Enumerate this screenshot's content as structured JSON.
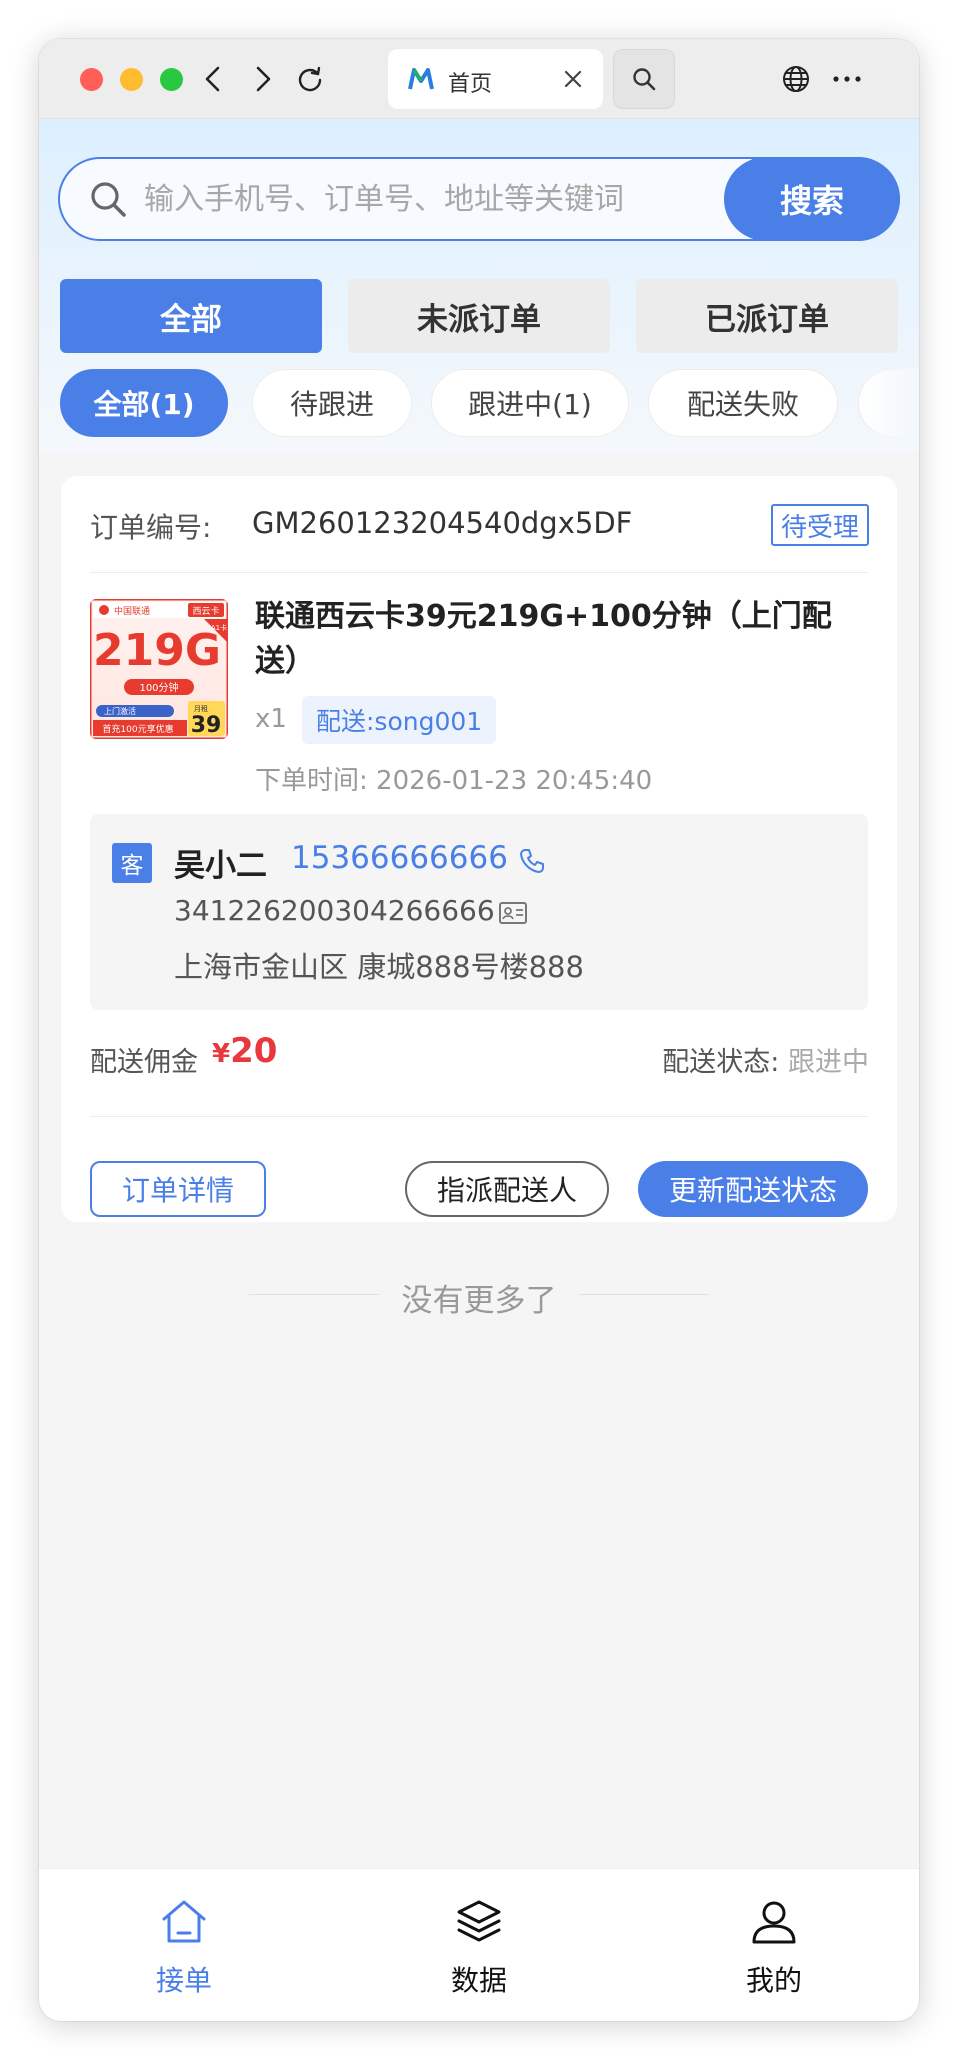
{
  "browser": {
    "tab_title": "首页"
  },
  "search": {
    "placeholder": "输入手机号、订单号、地址等关键词",
    "button_label": "搜索"
  },
  "main_tabs": [
    {
      "label": "全部",
      "active": true
    },
    {
      "label": "未派订单",
      "active": false
    },
    {
      "label": "已派订单",
      "active": false
    }
  ],
  "filter_pills": [
    {
      "label": "全部(1)",
      "active": true
    },
    {
      "label": "待跟进",
      "active": false
    },
    {
      "label": "跟进中(1)",
      "active": false
    },
    {
      "label": "配送失败",
      "active": false
    }
  ],
  "order": {
    "order_no_label": "订单编号:",
    "order_no": "GM260123204540dgx5DF",
    "status": "待受理",
    "product": {
      "image_text": {
        "brand": "中国联通",
        "card_name": "西云卡",
        "data_amount": "219G",
        "minutes": "100分钟",
        "delivery": "上门激活",
        "promo": "首充100元享优惠",
        "price_prefix": "月租",
        "price": "39",
        "ribbon": "A1卡"
      },
      "title": "联通西云卡39元219G+100分钟（上门配送）",
      "quantity": "x1",
      "delivery_tag": "配送:song001",
      "order_time": "下单时间: 2026-01-23 20:45:40"
    },
    "customer": {
      "tag": "客",
      "name": "吴小二",
      "phone": "15366666666",
      "id_number": "341226200304266666",
      "address": "上海市金山区 康城888号楼888"
    },
    "commission_label": "配送佣金",
    "commission_currency": "¥",
    "commission_value": "20",
    "delivery_status_label": "配送状态:",
    "delivery_status_value": "跟进中",
    "buttons": {
      "detail": "订单详情",
      "assign": "指派配送人",
      "update": "更新配送状态"
    }
  },
  "list_end_text": "没有更多了",
  "bottom_nav": [
    {
      "label": "接单",
      "icon": "home-icon",
      "active": true
    },
    {
      "label": "数据",
      "icon": "layers-icon",
      "active": false
    },
    {
      "label": "我的",
      "icon": "user-icon",
      "active": false
    }
  ],
  "colors": {
    "accent": "#4a7fe8",
    "price_red": "#e8383d"
  }
}
